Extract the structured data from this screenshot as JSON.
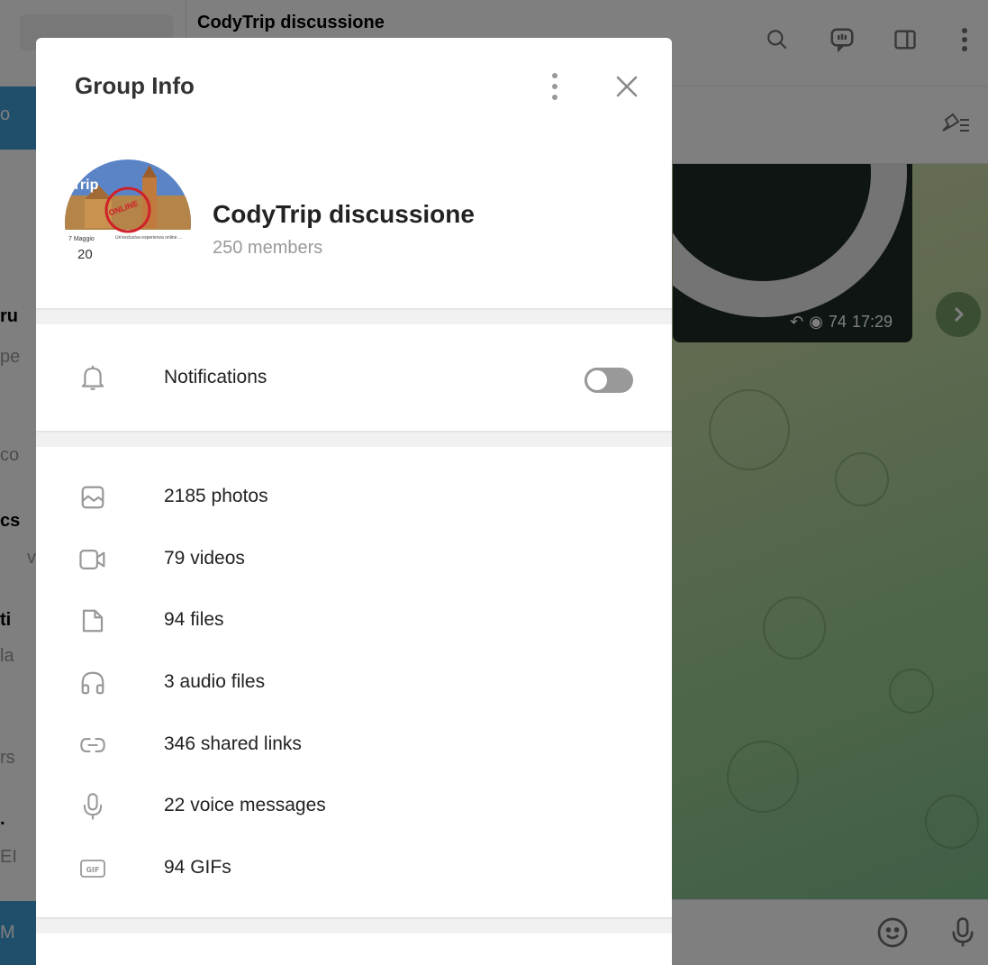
{
  "background": {
    "sidebar_fragments": [
      "o",
      "ru",
      "pe",
      "co",
      "cs",
      "v",
      "ti",
      "la",
      "rs",
      ".",
      "EI",
      "M"
    ],
    "chat_title": "CodyTrip discussione",
    "media_message": {
      "views": "74",
      "time": "17:29"
    }
  },
  "modal": {
    "title": "Group Info",
    "group": {
      "name": "CodyTrip discussione",
      "members": "250 members"
    },
    "avatar_text": {
      "line1": "Trip",
      "line2": "7 Maggio",
      "line3": "20",
      "stamp": "ONLINE",
      "blurb": "Un'esclusiva esperienza online ..."
    },
    "notifications": {
      "label": "Notifications",
      "enabled": false
    },
    "media": [
      {
        "icon": "photo-icon",
        "label": "2185 photos"
      },
      {
        "icon": "video-icon",
        "label": "79 videos"
      },
      {
        "icon": "file-icon",
        "label": "94 files"
      },
      {
        "icon": "headphones-icon",
        "label": "3 audio files"
      },
      {
        "icon": "link-icon",
        "label": "346 shared links"
      },
      {
        "icon": "microphone-icon",
        "label": "22 voice messages"
      },
      {
        "icon": "gif-icon",
        "label": "94 GIFs"
      }
    ]
  },
  "colors": {
    "accent": "#419fd9",
    "icon_gray": "#999999",
    "text_dark": "#222222",
    "muted": "#999999",
    "overlay": "rgba(0,0,0,0.5)"
  }
}
